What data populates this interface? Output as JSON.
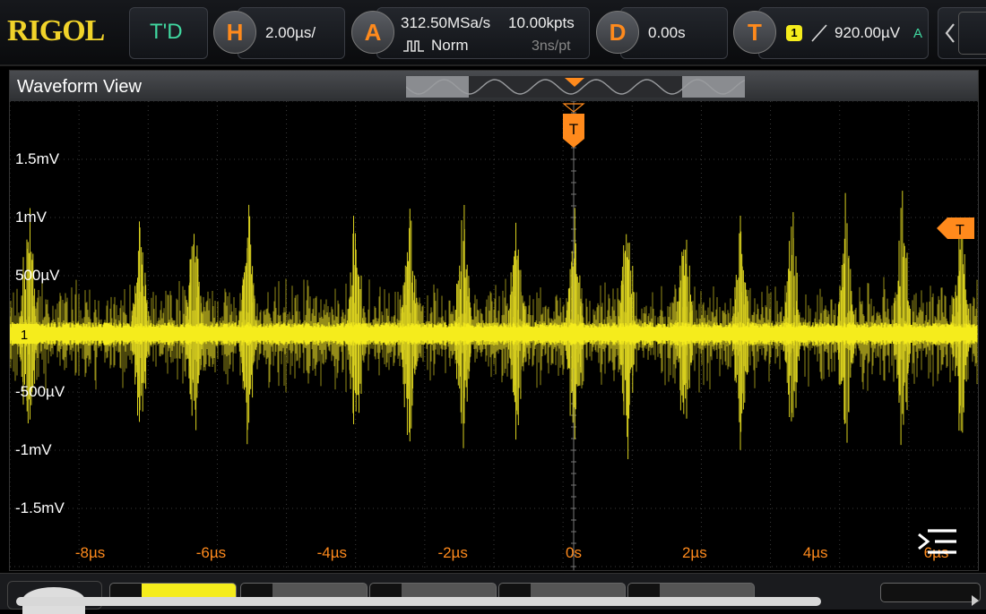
{
  "brand": "RIGOL",
  "mode": "T'D",
  "horizontal": {
    "key": "H",
    "timebase": "2.00µs/"
  },
  "acquire": {
    "key": "A",
    "sample_rate": "312.50MSa/s",
    "memory_depth": "10.00kpts",
    "mode": "Norm",
    "resolution": "3ns/pt"
  },
  "delay": {
    "key": "D",
    "value": "0.00s"
  },
  "trigger": {
    "key": "T",
    "source": "1",
    "level": "920.00µV",
    "sweep": "A"
  },
  "view": {
    "title": "Waveform View",
    "trigger_marker": "T",
    "level_marker": "T",
    "channel_marker": "1"
  },
  "y_labels": [
    "1.5mV",
    "1mV",
    "500µV",
    "-500µV",
    "-1mV",
    "-1.5mV"
  ],
  "x_labels": [
    "-8µs",
    "-6µs",
    "-4µs",
    "-2µs",
    "0s",
    "2µs",
    "4µs",
    "6µs"
  ],
  "colors": {
    "ch1": "#f5ec1c",
    "accent": "#ff8a1c",
    "brand": "#f1d32a",
    "mode": "#40d8a0"
  }
}
